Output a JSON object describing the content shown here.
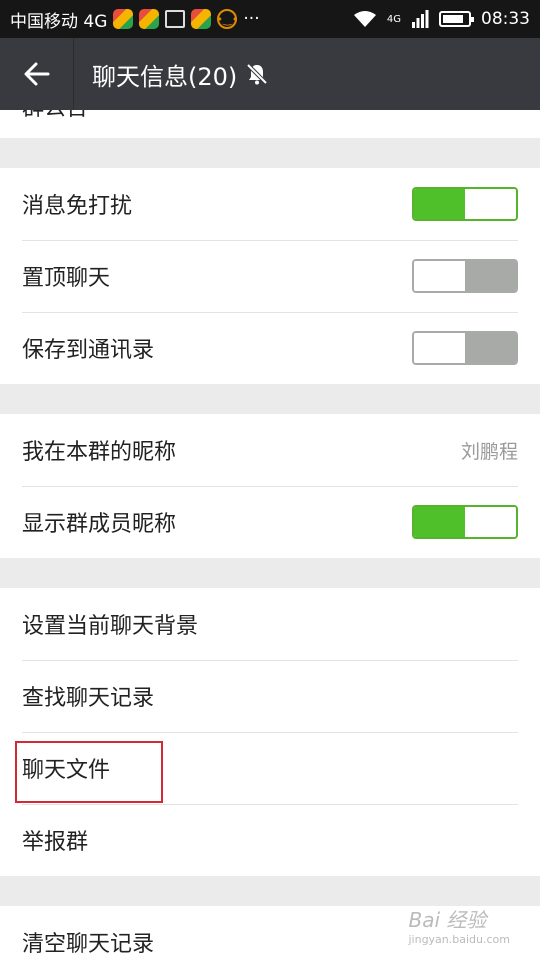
{
  "status_bar": {
    "carrier": "中国移动 4G",
    "more": "···",
    "network": "4G",
    "time": "08:33"
  },
  "header": {
    "back_icon": "arrow-left-icon",
    "title": "聊天信息(20)",
    "mute_icon": "bell-muted-icon"
  },
  "sections": [
    {
      "items": [
        {
          "label": "群公告"
        }
      ]
    },
    {
      "items": [
        {
          "label": "消息免打扰",
          "toggle": true
        },
        {
          "label": "置顶聊天",
          "toggle": false
        },
        {
          "label": "保存到通讯录",
          "toggle": false
        }
      ]
    },
    {
      "items": [
        {
          "label": "我在本群的昵称",
          "value": "刘鹏程"
        },
        {
          "label": "显示群成员昵称",
          "toggle": true
        }
      ]
    },
    {
      "items": [
        {
          "label": "设置当前聊天背景"
        },
        {
          "label": "查找聊天记录"
        },
        {
          "label": "聊天文件"
        },
        {
          "label": "举报群"
        }
      ]
    },
    {
      "items": [
        {
          "label": "清空聊天记录"
        }
      ]
    }
  ],
  "colors": {
    "title_bar": "#393a3f",
    "toggle_on": "#4fbf2a",
    "toggle_off": "#a7aaa7",
    "highlight": "#d22a36"
  },
  "watermark": {
    "brand": "Bai 经验",
    "url": "jingyan.baidu.com"
  }
}
